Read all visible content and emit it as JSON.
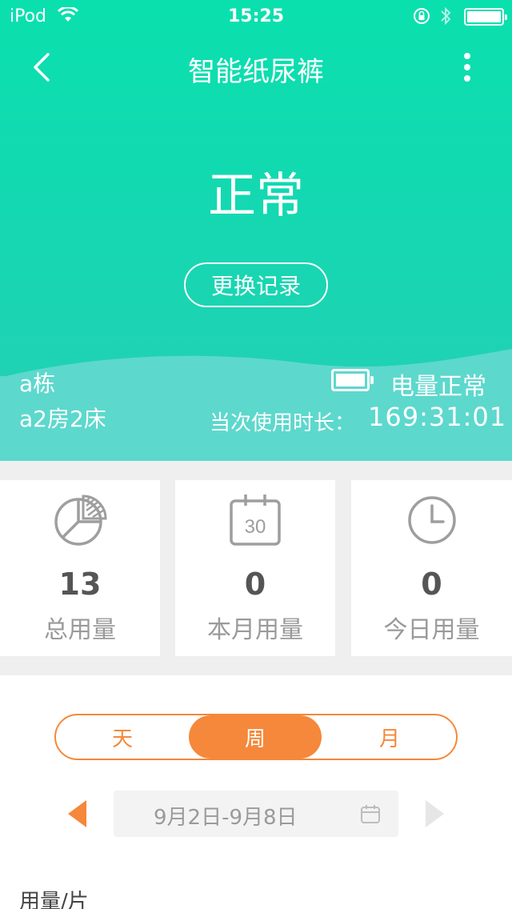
{
  "status_bar": {
    "carrier": "iPod",
    "time": "15:25"
  },
  "nav": {
    "title": "智能纸尿裤"
  },
  "hero": {
    "status": "正常",
    "record_button": "更换记录",
    "building": "a栋",
    "room": "a2房2床",
    "battery_status": "电量正常",
    "usage_label": "当次使用时长：",
    "usage_duration": "169:31:01"
  },
  "stats": [
    {
      "icon": "pie-chart-icon",
      "value": "13",
      "label": "总用量"
    },
    {
      "icon": "calendar-30-icon",
      "value": "0",
      "label": "本月用量",
      "calendar_day": "30"
    },
    {
      "icon": "clock-icon",
      "value": "0",
      "label": "今日用量"
    }
  ],
  "segment": {
    "options": [
      "天",
      "周",
      "月"
    ],
    "selected": "周"
  },
  "date_nav": {
    "range": "9月2日-9月8日"
  },
  "chart": {
    "ylabel": "用量/片"
  },
  "colors": {
    "hero_top": "#0ae0ae",
    "hero_bottom": "#5dd8cd",
    "accent": "#f5883a",
    "stat_text": "#555555",
    "muted_text": "#9a9a9a"
  }
}
